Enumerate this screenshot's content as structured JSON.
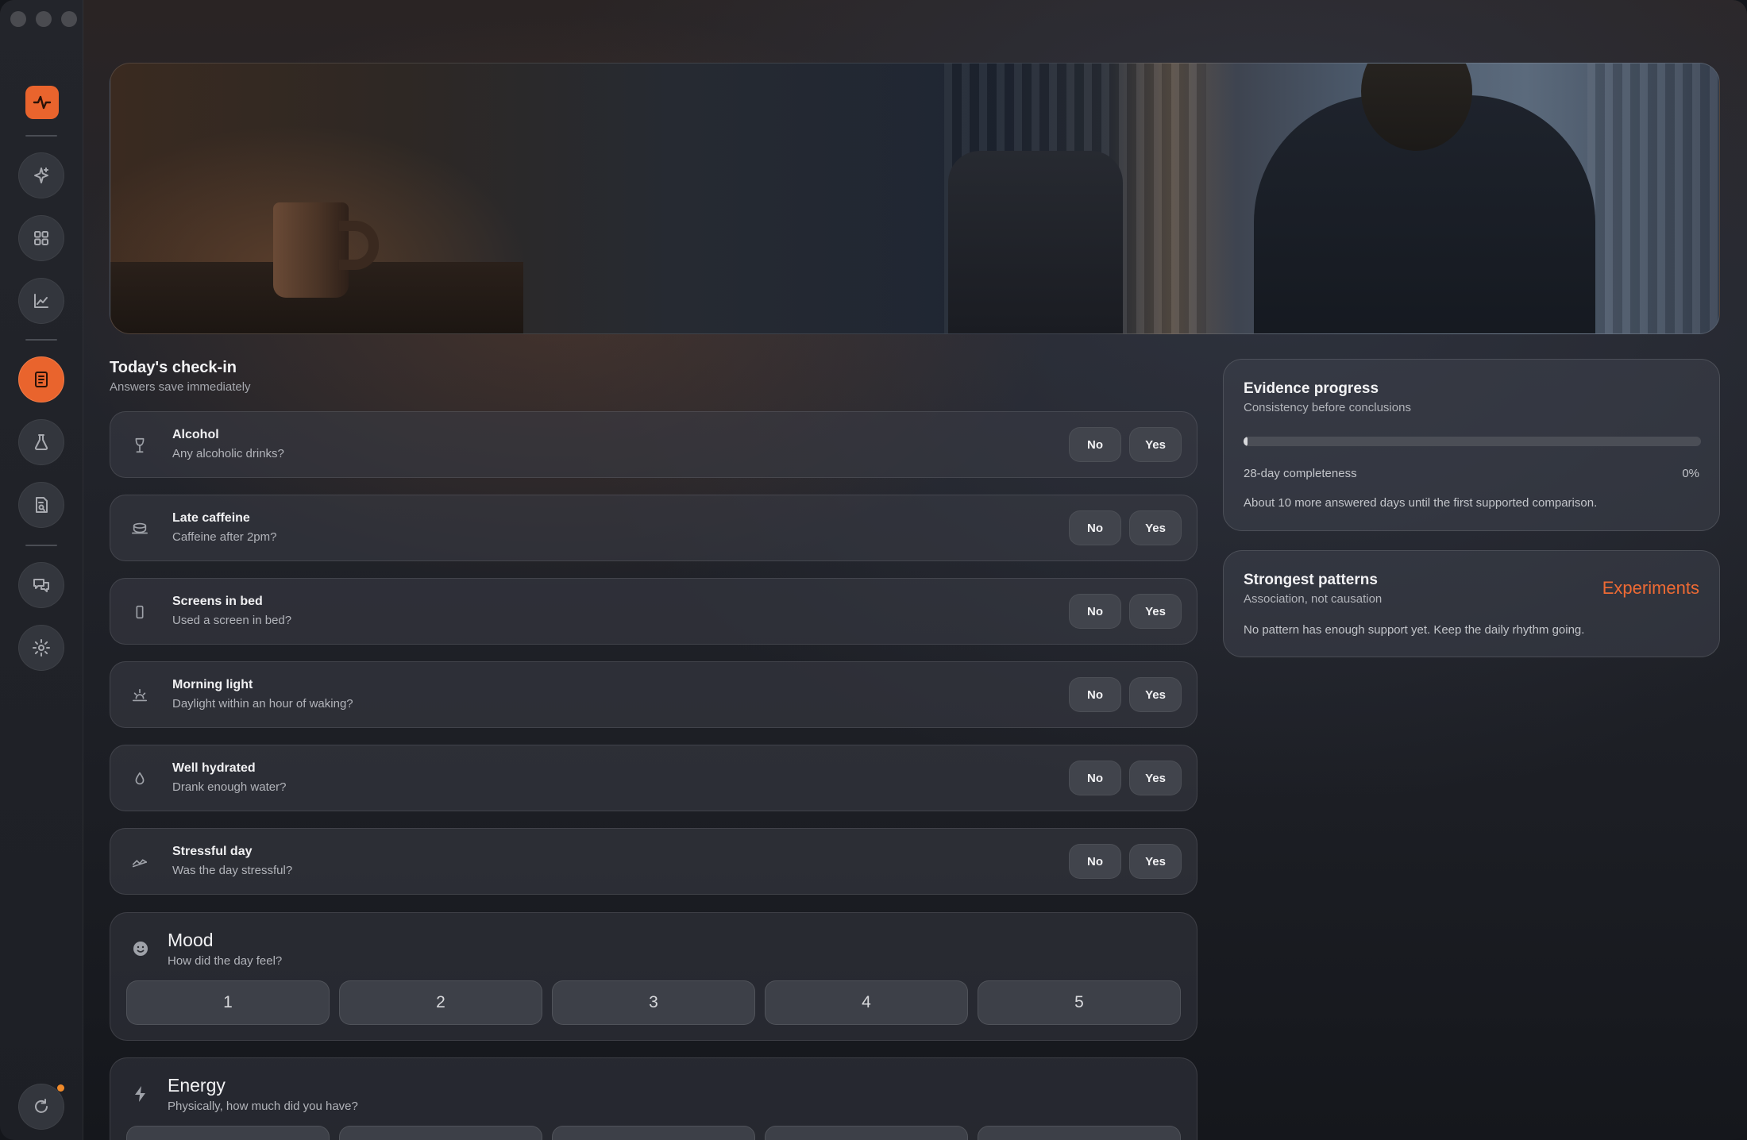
{
  "checkin": {
    "title": "Today's check-in",
    "subtitle": "Answers save immediately",
    "no_label": "No",
    "yes_label": "Yes",
    "questions": [
      {
        "title": "Alcohol",
        "subtitle": "Any alcoholic drinks?",
        "icon": "wine-glass-icon"
      },
      {
        "title": "Late caffeine",
        "subtitle": "Caffeine after 2pm?",
        "icon": "coffee-cup-icon"
      },
      {
        "title": "Screens in bed",
        "subtitle": "Used a screen in bed?",
        "icon": "phone-icon"
      },
      {
        "title": "Morning light",
        "subtitle": "Daylight within an hour of waking?",
        "icon": "sunrise-icon"
      },
      {
        "title": "Well hydrated",
        "subtitle": "Drank enough water?",
        "icon": "water-drop-icon"
      },
      {
        "title": "Stressful day",
        "subtitle": "Was the day stressful?",
        "icon": "wave-icon"
      }
    ]
  },
  "mood": {
    "title": "Mood",
    "subtitle": "How did the day feel?",
    "options": [
      "1",
      "2",
      "3",
      "4",
      "5"
    ],
    "icon": "smiley-icon"
  },
  "energy": {
    "title": "Energy",
    "subtitle": "Physically, how much did you have?",
    "icon": "lightning-icon"
  },
  "evidence": {
    "title": "Evidence progress",
    "subtitle": "Consistency before conclusions",
    "progress_label": "28-day completeness",
    "progress_value": "0%",
    "progress_fraction": 0,
    "note": "About 10 more answered days until the first supported comparison."
  },
  "patterns": {
    "title": "Strongest patterns",
    "subtitle": "Association, not causation",
    "link": "Experiments",
    "note": "No pattern has enough support yet. Keep the daily rhythm going."
  },
  "colors": {
    "accent": "#e9642d",
    "background": "#1c1e24"
  },
  "sidebar_icons": [
    "pulse-icon",
    "sparkle-icon",
    "grid-icon",
    "chart-icon",
    "journal-icon",
    "flask-icon",
    "report-icon",
    "chat-icon",
    "gear-icon",
    "refresh-icon"
  ]
}
